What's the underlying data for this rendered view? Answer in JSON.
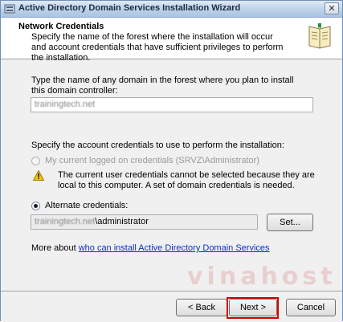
{
  "window": {
    "title": "Active Directory Domain Services Installation Wizard",
    "close_glyph": "✕"
  },
  "header": {
    "title": "Network Credentials",
    "description": "Specify the name of the forest where the installation will occur and account credentials that have sufficient privileges to perform the installation."
  },
  "domain": {
    "prompt": "Type the name of any domain in the forest where you plan to install this domain controller:",
    "value": "trainingtech.net"
  },
  "credentials": {
    "prompt": "Specify the account credentials to use to perform the installation:",
    "current_option": "My current logged on credentials (SRVZ\\Administrator)",
    "warning": "The current user credentials cannot be selected because they are local to this computer. A set of domain credentials is needed.",
    "alternate_option": "Alternate credentials:",
    "alternate_domain": "trainingtech.net",
    "alternate_user": "\\administrator",
    "set_button": "Set..."
  },
  "more_about": {
    "prefix": "More about ",
    "link": "who can install Active Directory Domain Services"
  },
  "buttons": {
    "back": "< Back",
    "next": "Next >",
    "cancel": "Cancel"
  },
  "watermark": "vinahost",
  "colors": {
    "highlight": "#d90000",
    "link": "#0033cc",
    "titlebar": "#b9d1ea"
  }
}
